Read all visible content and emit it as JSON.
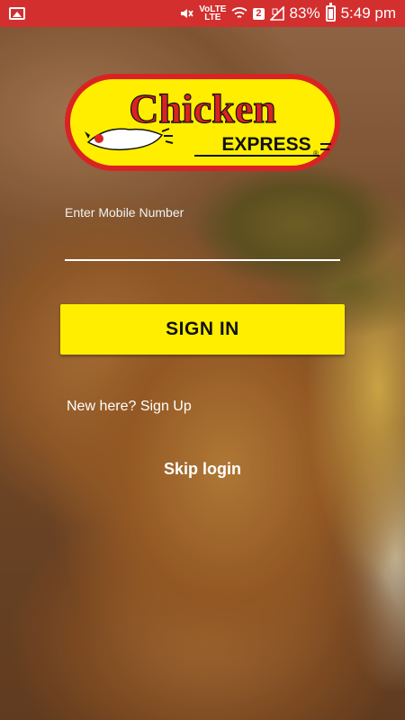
{
  "status_bar": {
    "network_small": "VoLTE",
    "lte_label": "LTE",
    "sim_badge": "2",
    "battery": "83%",
    "time": "5:49 pm"
  },
  "logo": {
    "word_top": "Chicken",
    "word_bottom": "EXPRESS",
    "registered": "®"
  },
  "form": {
    "mobile_label": "Enter Mobile Number",
    "mobile_value": "",
    "signin_label": "SIGN IN",
    "signup_text": "New here? Sign Up",
    "skip_text": "Skip login"
  },
  "colors": {
    "status_bar": "#d32f2f",
    "button": "#ffee00",
    "logo_red": "#d92323",
    "logo_yellow": "#ffee00"
  }
}
